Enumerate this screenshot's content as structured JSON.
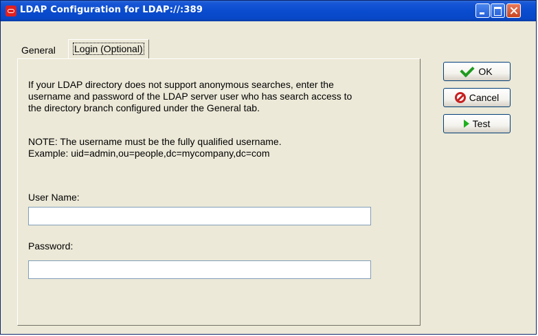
{
  "window": {
    "title": "LDAP Configuration for LDAP://:389",
    "controls": [
      "minimize",
      "maximize",
      "close"
    ]
  },
  "tabs": [
    {
      "label": "General",
      "active": false
    },
    {
      "label": "Login (Optional)",
      "active": true
    }
  ],
  "login": {
    "description_lines": [
      "If your LDAP directory does not support anonymous searches, enter the",
      "username and password of the LDAP server user who has search access to",
      "the directory branch configured under the General tab."
    ],
    "note_lines": [
      "NOTE: The username must be the fully qualified username.",
      "Example: uid=admin,ou=people,dc=mycompany,dc=com"
    ],
    "username_label": "User Name:",
    "username_value": "",
    "password_label": "Password:",
    "password_value": ""
  },
  "buttons": {
    "ok": "OK",
    "cancel": "Cancel",
    "test": "Test"
  },
  "icons": {
    "app": "oracle-icon",
    "ok": "checkmark-icon",
    "cancel": "stop-icon",
    "test": "play-icon"
  },
  "colors": {
    "titlebar": "#0a4ccf",
    "window_bg": "#ece9d8",
    "ok_icon": "#1f9a1f",
    "cancel_icon": "#c82020",
    "test_icon": "#1fb01f"
  }
}
